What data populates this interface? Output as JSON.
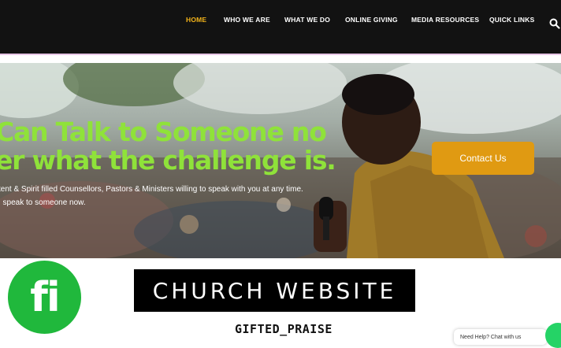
{
  "nav": {
    "items": [
      {
        "label": "HOME",
        "active": true
      },
      {
        "label": "WHO WE ARE",
        "active": false
      },
      {
        "label": "WHAT WE DO",
        "active": false
      },
      {
        "label": "ONLINE GIVING",
        "active": false
      },
      {
        "label": "MEDIA RESOURCES",
        "active": false
      },
      {
        "label": "QUICK LINKS",
        "active": false
      }
    ],
    "search_icon": "search-icon",
    "active_color": "#f4b41a"
  },
  "hero": {
    "title_line1": "Can Talk to Someone no",
    "title_line2": "er what the challenge is.",
    "subtitle_line1": "tent & Spirit filled Counsellors, Pastors & Ministers willing to speak with you at any time.",
    "subtitle_line2": ", speak to someone now.",
    "contact_button": "Contact Us",
    "title_color": "#8fe23a",
    "button_color": "#e09a12"
  },
  "overlay": {
    "logo_text": "fi",
    "logo_color": "#20b83c",
    "banner_text": "CHURCH WEBSITE",
    "handle": "GIFTED_PRAISE"
  },
  "chat": {
    "bubble_text": "Need Help? Chat with us",
    "icon": "whatsapp-icon"
  }
}
